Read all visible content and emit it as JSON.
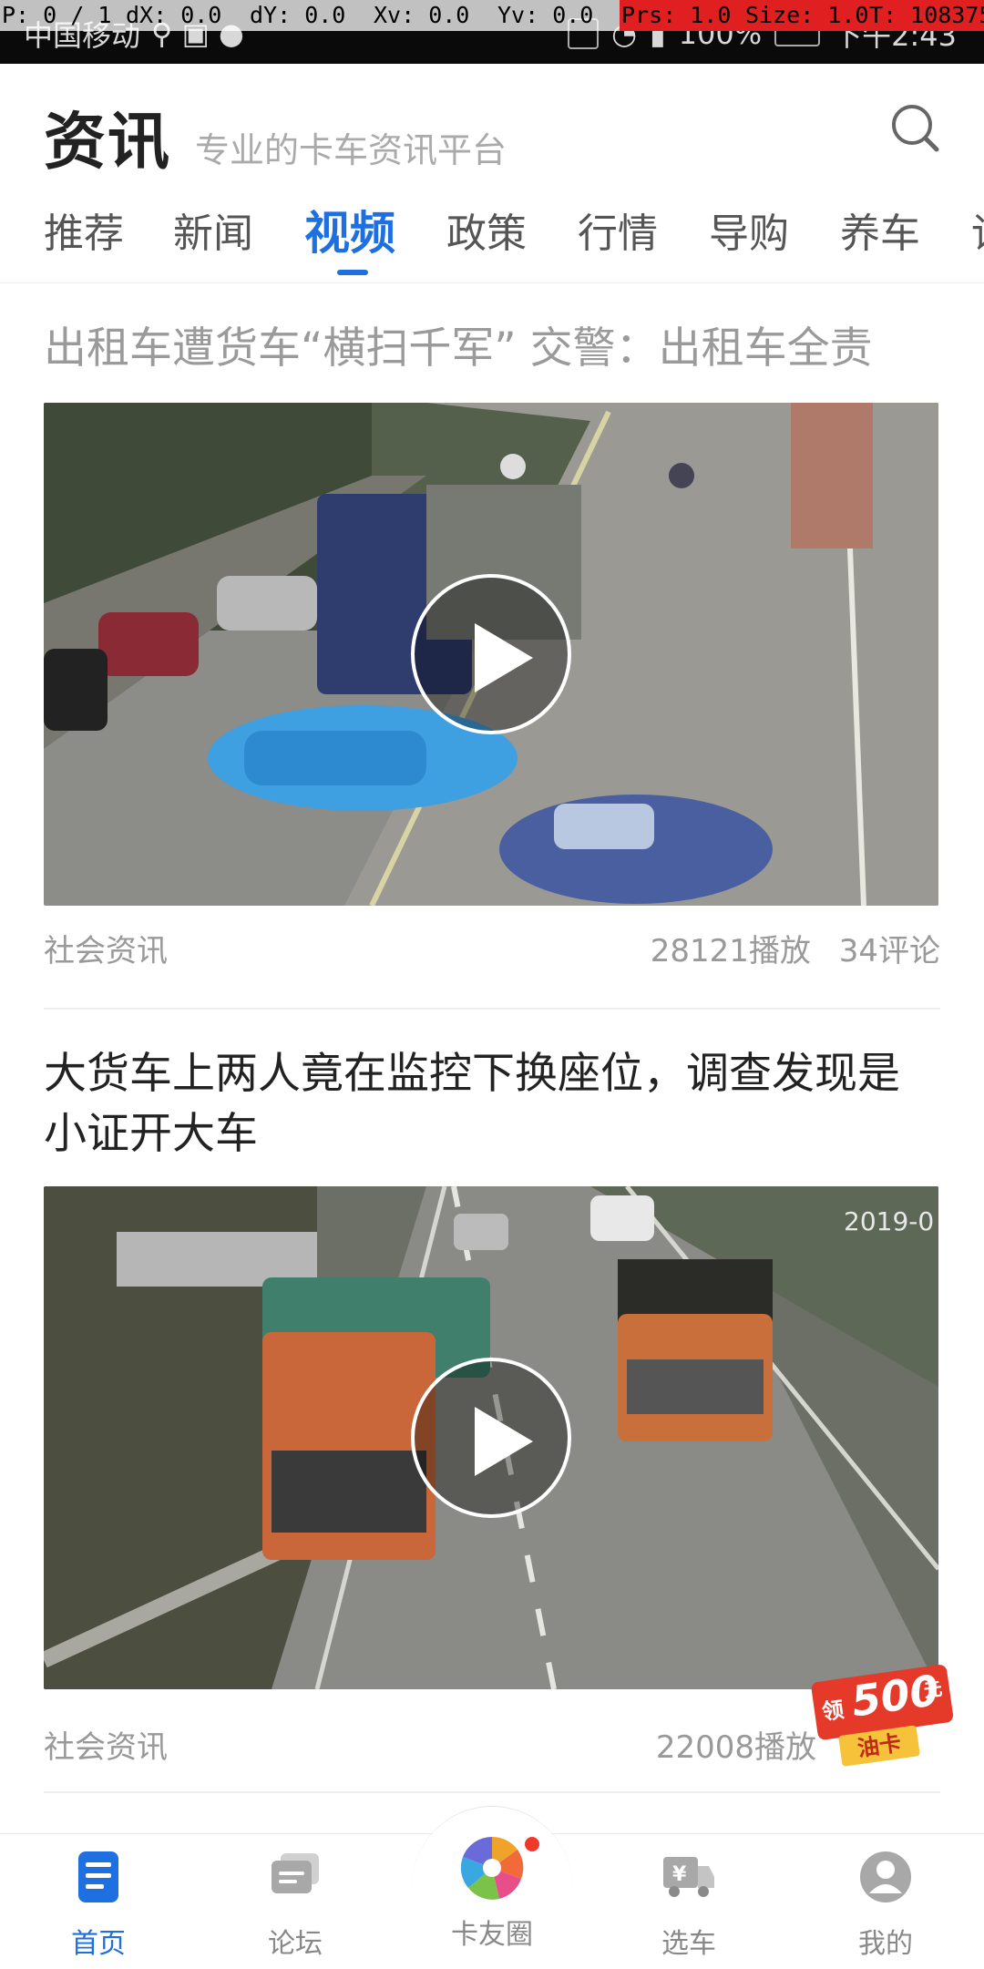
{
  "debug_bar": {
    "p": "P: 0 / 1",
    "dx": "dX: 0.0",
    "dy": "dY: 0.0",
    "xv": "Xv: 0.0",
    "yv": "Yv: 0.0",
    "prs": "Prs: 1.0",
    "size": "Size: 1.0",
    "t": "T: 108375"
  },
  "status_bar": {
    "carrier": "中国移动",
    "battery": "100%",
    "time": "下午2:43"
  },
  "header": {
    "title": "资讯",
    "slogan": "专业的卡车资讯平台"
  },
  "tabs": [
    {
      "label": "推荐",
      "active": false
    },
    {
      "label": "新闻",
      "active": false
    },
    {
      "label": "视频",
      "active": true
    },
    {
      "label": "政策",
      "active": false
    },
    {
      "label": "行情",
      "active": false
    },
    {
      "label": "导购",
      "active": false
    },
    {
      "label": "养车",
      "active": false
    },
    {
      "label": "论",
      "active": false
    }
  ],
  "feed": [
    {
      "title": "出租车遭货车“横扫千军” 交警：出租车全责",
      "source": "社会资讯",
      "plays": "28121播放",
      "comments": "34评论"
    },
    {
      "title": "大货车上两人竟在监控下换座位，调查发现是小证开大车",
      "source": "社会资讯",
      "plays": "22008播放",
      "video_timestamp": "2019-0"
    }
  ],
  "promo": {
    "prefix": "领",
    "amount": "500",
    "unit": "元",
    "label": "油卡"
  },
  "bottom_nav": [
    {
      "label": "首页",
      "icon": "home-doc-icon",
      "active": true
    },
    {
      "label": "论坛",
      "icon": "forum-chat-icon",
      "active": false
    },
    {
      "label": "卡友圈",
      "icon": "pinwheel-icon",
      "active": false
    },
    {
      "label": "选车",
      "icon": "truck-yuan-icon",
      "active": false
    },
    {
      "label": "我的",
      "icon": "user-profile-icon",
      "active": false
    }
  ],
  "colors": {
    "accent": "#1e6fe0",
    "debug_red": "#e02020",
    "promo_red": "#e53a2a",
    "promo_yellow": "#f5c23a"
  }
}
